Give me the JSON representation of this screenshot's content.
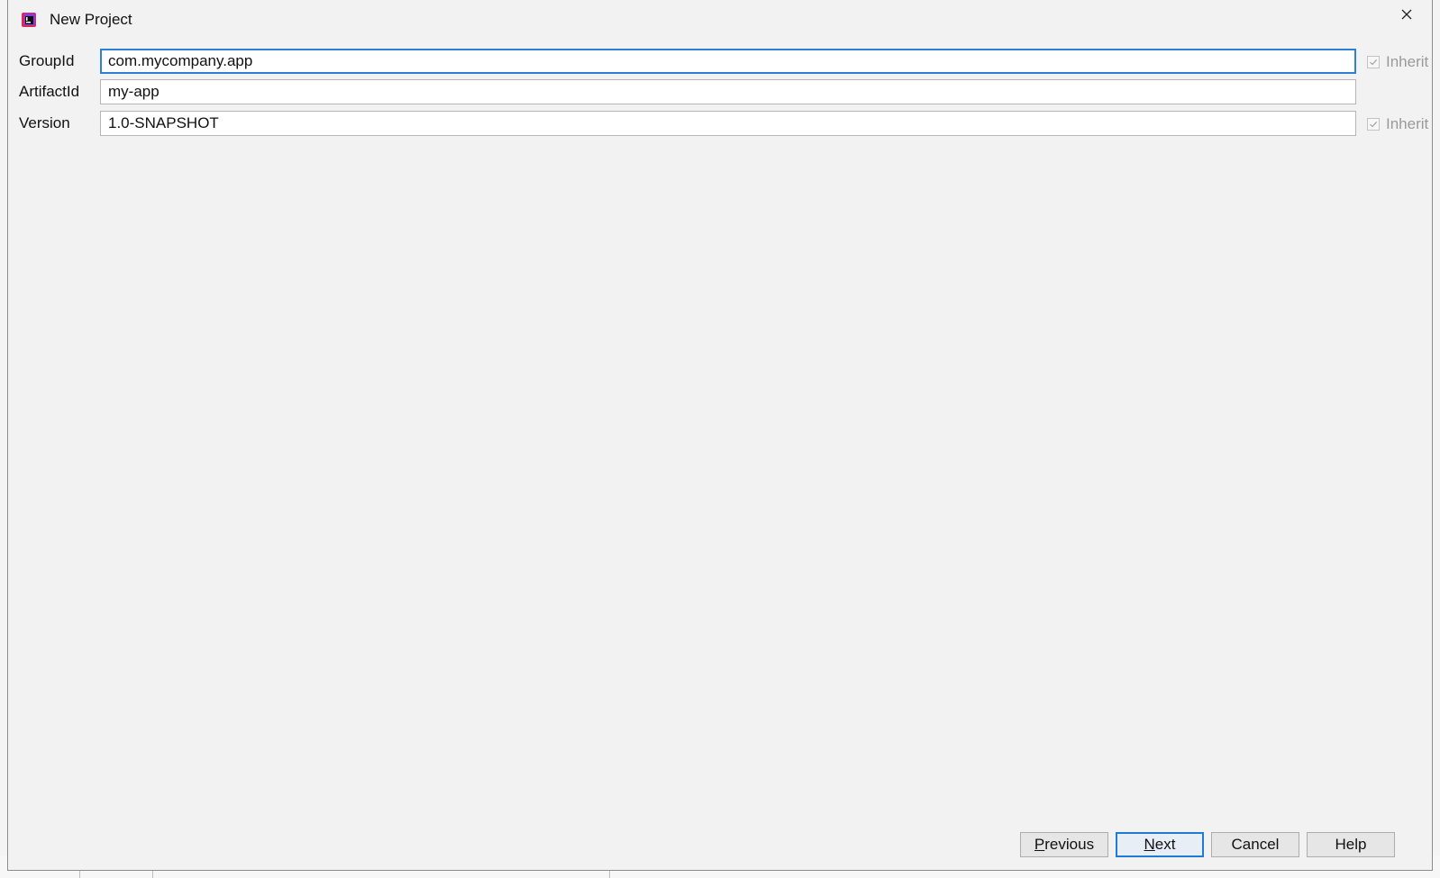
{
  "window": {
    "title": "New Project",
    "close_symbol": "✕"
  },
  "form": {
    "rows": [
      {
        "label": "GroupId",
        "value": "com.mycompany.app",
        "inherit_label": "Inherit",
        "inherit_checked": true
      },
      {
        "label": "ArtifactId",
        "value": "my-app"
      },
      {
        "label": "Version",
        "value": "1.0-SNAPSHOT",
        "inherit_label": "Inherit",
        "inherit_checked": true
      }
    ]
  },
  "buttons": {
    "previous": {
      "mnemonic": "P",
      "rest": "revious"
    },
    "next": {
      "mnemonic": "N",
      "rest": "ext"
    },
    "cancel": "Cancel",
    "help": "Help"
  },
  "colors": {
    "dialog_bg": "#f2f2f2",
    "focus_border": "#2f7fd6",
    "default_button_border": "#1e7bd8"
  },
  "icons": {
    "app": "intellij-idea-icon",
    "close": "close-icon",
    "checkbox": "check-icon"
  }
}
